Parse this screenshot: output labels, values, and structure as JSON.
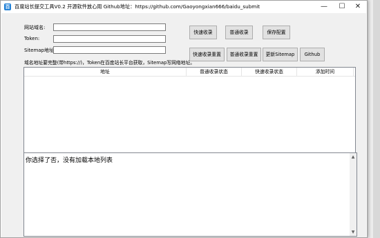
{
  "window": {
    "title": "百度站长提交工具V0.2 开源软件放心用 Github地址：https://github.com/Gaoyongxian666/baidu_submit",
    "app_icon": "百",
    "controls": {
      "minimize": "—",
      "maximize": "☐",
      "close": "✕"
    }
  },
  "form": {
    "site_label": "网站域名:",
    "site_value": "",
    "token_label": "Token:",
    "token_value": "",
    "sitemap_label": "Sitemap地址:",
    "sitemap_value": "",
    "hint": "域名地址要完整(带https://)，Token在百度站长平台获取，Sitemap写网络地址。"
  },
  "buttons": {
    "fast_submit": "快速收录",
    "normal_submit": "普通收录",
    "save_config": "保存配置",
    "fast_reset": "快速收录重置",
    "normal_reset": "普通收录重置",
    "update_sitemap": "更新Sitemap",
    "github": "Github"
  },
  "table": {
    "columns": [
      "地址",
      "普通收录状态",
      "快速收录状态",
      "添加时间"
    ],
    "rows": []
  },
  "log": {
    "text": "你选择了否，没有加载本地列表"
  }
}
